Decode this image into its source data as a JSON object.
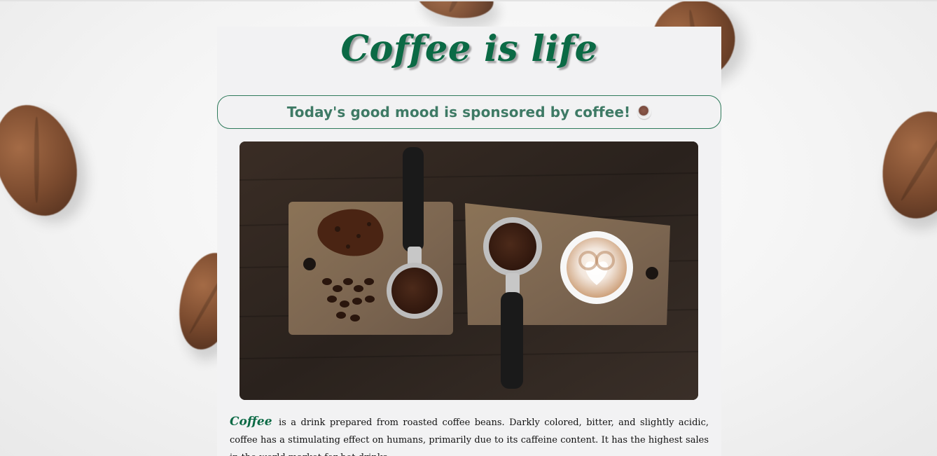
{
  "page": {
    "title": "Coffee is life",
    "banner_text": "Today's good mood is sponsored by coffee!",
    "banner_icon": "coffee-cup-icon",
    "paragraph": {
      "lead_word": "Coffee",
      "text": "is a drink prepared from roasted coffee beans. Darkly colored, bitter, and slightly acidic, coffee has a stimulating effect on humans, primarily due to its caffeine content. It has the highest sales in the world market for hot drinks."
    }
  },
  "colors": {
    "accent_green": "#0b6a45",
    "banner_text": "#3e7a65",
    "card_bg": "#f2f2f3"
  }
}
